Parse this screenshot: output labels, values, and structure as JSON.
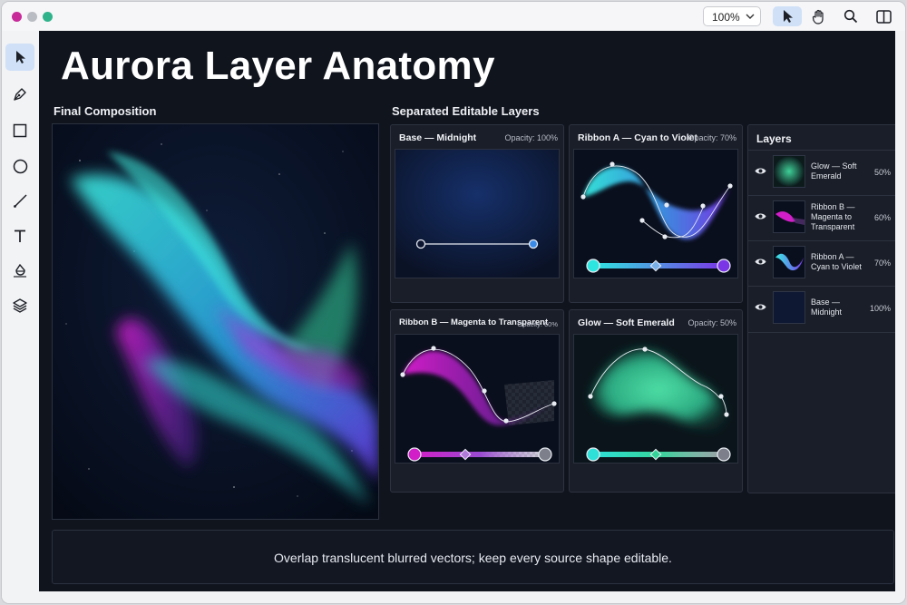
{
  "toolbar": {
    "zoom_value": "100%",
    "icons": [
      "pointer-icon",
      "hand-icon",
      "search-icon",
      "split-view-icon"
    ]
  },
  "sidebar": {
    "tools": [
      "pointer-icon",
      "pen-icon",
      "rectangle-icon",
      "ellipse-icon",
      "line-icon",
      "text-icon",
      "fill-icon",
      "layers-icon"
    ]
  },
  "main": {
    "title": "Aurora Layer Anatomy",
    "composition_heading": "Final Composition",
    "layers_heading": "Separated Editable Layers"
  },
  "cards": [
    {
      "title": "Base — Midnight",
      "opacity": "Opacity: 100%"
    },
    {
      "title": "Ribbon A — Cyan to Violet",
      "opacity": "Opacity: 70%"
    },
    {
      "title": "Ribbon B — Magenta to Transparent",
      "opacity": "Opacity: 60%"
    },
    {
      "title": "Glow — Soft Emerald",
      "opacity": "Opacity: 50%"
    }
  ],
  "layers_panel": {
    "heading": "Layers",
    "items": [
      {
        "name": "Glow — Soft Emerald",
        "opacity": "50%"
      },
      {
        "name": "Ribbon B — Magenta to Transparent",
        "opacity": "60%"
      },
      {
        "name": "Ribbon A — Cyan to Violet",
        "opacity": "70%"
      },
      {
        "name": "Base — Midnight",
        "opacity": "100%"
      }
    ]
  },
  "caption": "Overlap translucent blurred vectors; keep every source shape editable.",
  "colors": {
    "accent": "#1e4f9c",
    "cyan": "#2ee6e0",
    "violet": "#7a35e6",
    "magenta": "#d21ec8",
    "emerald": "#34d39a",
    "midnight": "#0c1530"
  }
}
